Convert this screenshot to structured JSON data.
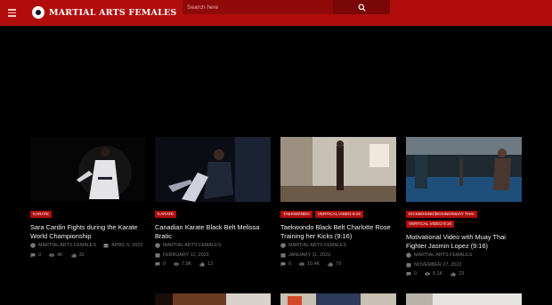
{
  "site": {
    "logo_text": "MARTIAL ARTS FEMALES",
    "search_placeholder": "Search here"
  },
  "posts": [
    {
      "categories": [
        "KARATE"
      ],
      "title": "Sara Cardin Fights during the Karate World Championship",
      "author": "MARTIAL ARTS FEMALES",
      "date": "APRIL 5, 2023",
      "comments": "0",
      "views": "4K",
      "likes": "32"
    },
    {
      "categories": [
        "KARATE"
      ],
      "title": "Canadian Karate Black Belt Melissa Bratic",
      "author": "MARTIAL ARTS FEMALES",
      "date": "FEBRUARY 12, 2023",
      "comments": "0",
      "views": "7.9K",
      "likes": "12"
    },
    {
      "categories": [
        "TAEKWONDO",
        "VERTICAL VIDEO 9:16"
      ],
      "title": "Taekwondo Black Belt Charlotte Rose Training her Kicks (9:16)",
      "author": "MARTIAL ARTS FEMALES",
      "date": "JANUARY 11, 2023",
      "comments": "0",
      "views": "10.4K",
      "likes": "79"
    },
    {
      "categories": [
        "KICKBOXING/BOXING/MUAY THAI",
        "VERTICAL VIDEO 9:16"
      ],
      "title": "Motivational Video with Muay Thai Fighter Jasmin Lopez (9:16)",
      "author": "MARTIAL ARTS FEMALES",
      "date": "NOVEMBER 27, 2022",
      "comments": "0",
      "views": "5.1K",
      "likes": "23"
    }
  ]
}
